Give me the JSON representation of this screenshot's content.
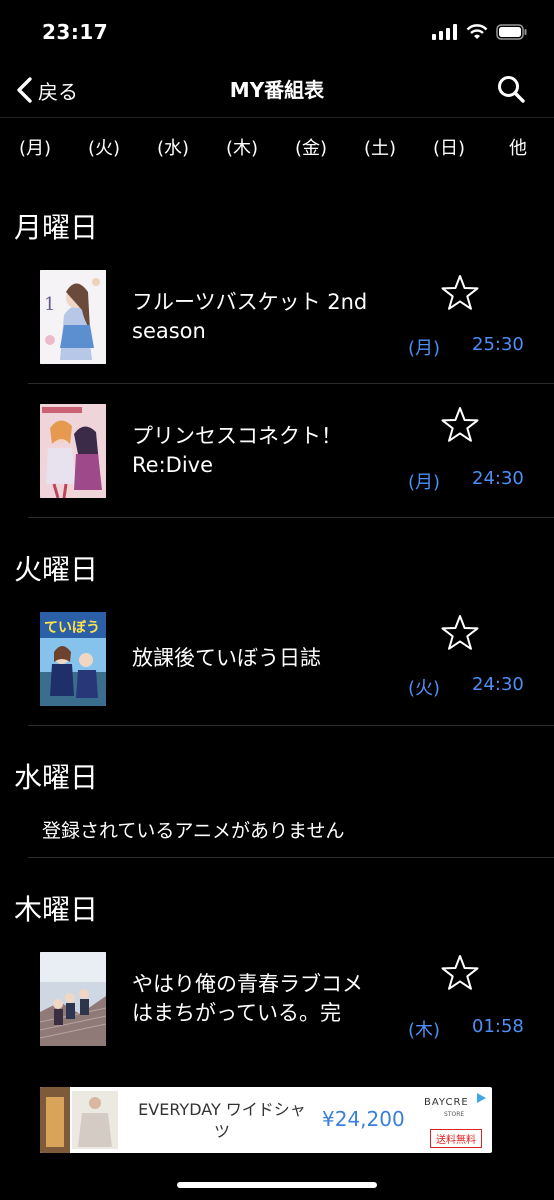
{
  "status": {
    "time": "23:17"
  },
  "nav": {
    "back_label": "戻る",
    "title": "MY番組表"
  },
  "tabs": [
    "(月)",
    "(火)",
    "(水)",
    "(木)",
    "(金)",
    "(土)",
    "(日)",
    "他"
  ],
  "sections": [
    {
      "heading": "月曜日"
    },
    {
      "heading": "火曜日"
    },
    {
      "heading": "水曜日"
    },
    {
      "heading": "木曜日"
    }
  ],
  "programs": [
    {
      "title_line1": "フルーツバスケット 2nd",
      "title_line2": "season",
      "day": "(月)",
      "time": "25:30"
    },
    {
      "title_line1": "プリンセスコネクト！",
      "title_line2": "Re:Dive",
      "day": "(月)",
      "time": "24:30"
    },
    {
      "title_line1": "放課後ていぼう日誌",
      "title_line2": "",
      "day": "(火)",
      "time": "24:30"
    },
    {
      "title_line1": "やはり俺の青春ラブコメ",
      "title_line2": "はまちがっている。完",
      "day": "(木)",
      "time": "01:58"
    }
  ],
  "empty_message": "登録されているアニメがありません",
  "ad": {
    "product_line1": "EVERYDAY ワイドシャ",
    "product_line2": "ツ",
    "price": "¥24,200",
    "brand": "BAYCRE",
    "brand_sub": "STORE",
    "badge": "送料無料"
  },
  "colors": {
    "accent": "#4f8ef7",
    "background": "#000000"
  }
}
